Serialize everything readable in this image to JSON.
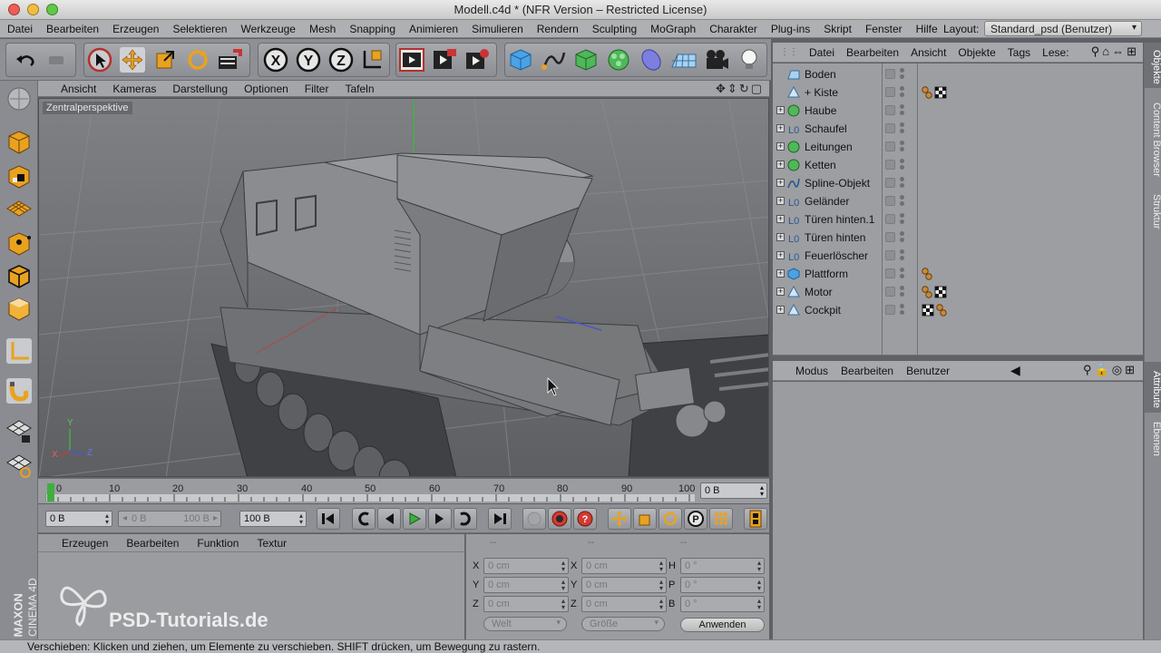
{
  "window": {
    "title": "Modell.c4d * (NFR Version – Restricted License)"
  },
  "menubar": {
    "items": [
      "Datei",
      "Bearbeiten",
      "Erzeugen",
      "Selektieren",
      "Werkzeuge",
      "Mesh",
      "Snapping",
      "Animieren",
      "Simulieren",
      "Rendern",
      "Sculpting",
      "MoGraph",
      "Charakter",
      "Plug-ins",
      "Skript",
      "Fenster",
      "Hilfe"
    ],
    "layout_label": "Layout:",
    "layout_value": "Standard_psd (Benutzer)"
  },
  "viewport": {
    "menu": [
      "Ansicht",
      "Kameras",
      "Darstellung",
      "Optionen",
      "Filter",
      "Tafeln"
    ],
    "label": "Zentralperspektive",
    "axis_labels": {
      "y": "Y",
      "x": "X",
      "z": "Z"
    }
  },
  "timeline": {
    "ticks": [
      "0",
      "10",
      "20",
      "30",
      "40",
      "50",
      "60",
      "70",
      "80",
      "90",
      "100"
    ],
    "current_frame": "0 B"
  },
  "transport": {
    "start": "0 B",
    "range_min": "0 B",
    "range_max": "100 B",
    "end": "100 B"
  },
  "material_manager": {
    "menu": [
      "Erzeugen",
      "Bearbeiten",
      "Funktion",
      "Textur"
    ]
  },
  "coordinates": {
    "headers": [
      "--",
      "--",
      "--"
    ],
    "rows": [
      {
        "a": "X",
        "av": "0 cm",
        "b": "X",
        "bv": "0 cm",
        "c": "H",
        "cv": "0 °"
      },
      {
        "a": "Y",
        "av": "0 cm",
        "b": "Y",
        "bv": "0 cm",
        "c": "P",
        "cv": "0 °"
      },
      {
        "a": "Z",
        "av": "0 cm",
        "b": "Z",
        "bv": "0 cm",
        "c": "B",
        "cv": "0 °"
      }
    ],
    "mode1": "Welt",
    "mode2": "Größe",
    "apply": "Anwenden"
  },
  "object_manager": {
    "menu": [
      "Datei",
      "Bearbeiten",
      "Ansicht",
      "Objekte",
      "Tags",
      "Lese:"
    ],
    "objects": [
      {
        "name": "Boden",
        "icon": "floor",
        "expand": false,
        "tags": []
      },
      {
        "name": "+ Kiste",
        "icon": "polygon",
        "expand": false,
        "tags": [
          "material",
          "checker"
        ]
      },
      {
        "name": "Haube",
        "icon": "sphere",
        "expand": true,
        "tags": []
      },
      {
        "name": "Schaufel",
        "icon": "null",
        "expand": true,
        "tags": []
      },
      {
        "name": "Leitungen",
        "icon": "sphere",
        "expand": true,
        "tags": []
      },
      {
        "name": "Ketten",
        "icon": "sphere",
        "expand": true,
        "tags": []
      },
      {
        "name": "Spline-Objekt",
        "icon": "spline",
        "expand": true,
        "tags": []
      },
      {
        "name": "Geländer",
        "icon": "null",
        "expand": true,
        "tags": []
      },
      {
        "name": "Türen hinten.1",
        "icon": "null",
        "expand": true,
        "tags": []
      },
      {
        "name": "Türen hinten",
        "icon": "null",
        "expand": true,
        "tags": []
      },
      {
        "name": "Feuerlöscher",
        "icon": "null",
        "expand": true,
        "tags": []
      },
      {
        "name": "Plattform",
        "icon": "cube",
        "expand": true,
        "tags": [
          "material"
        ]
      },
      {
        "name": "Motor",
        "icon": "polygon",
        "expand": true,
        "tags": [
          "material",
          "checker"
        ]
      },
      {
        "name": "Cockpit",
        "icon": "polygon",
        "expand": true,
        "tags": [
          "checker",
          "material"
        ]
      }
    ]
  },
  "attribute_manager": {
    "menu": [
      "Modus",
      "Bearbeiten",
      "Benutzer"
    ]
  },
  "right_tabs": [
    "Objekte",
    "Content Browser",
    "Struktur",
    "Attribute",
    "Ebenen"
  ],
  "brand": {
    "maxon": "MAXON",
    "cinema": "CINEMA 4D",
    "watermark": "PSD-Tutorials.de"
  },
  "status": "Verschieben: Klicken und ziehen, um Elemente zu verschieben. SHIFT drücken, um Bewegung zu rastern.",
  "colors": {
    "accent_green": "#3fae3f",
    "tag_orange": "#c98a3c",
    "ui_gray": "#9a9ca0"
  }
}
